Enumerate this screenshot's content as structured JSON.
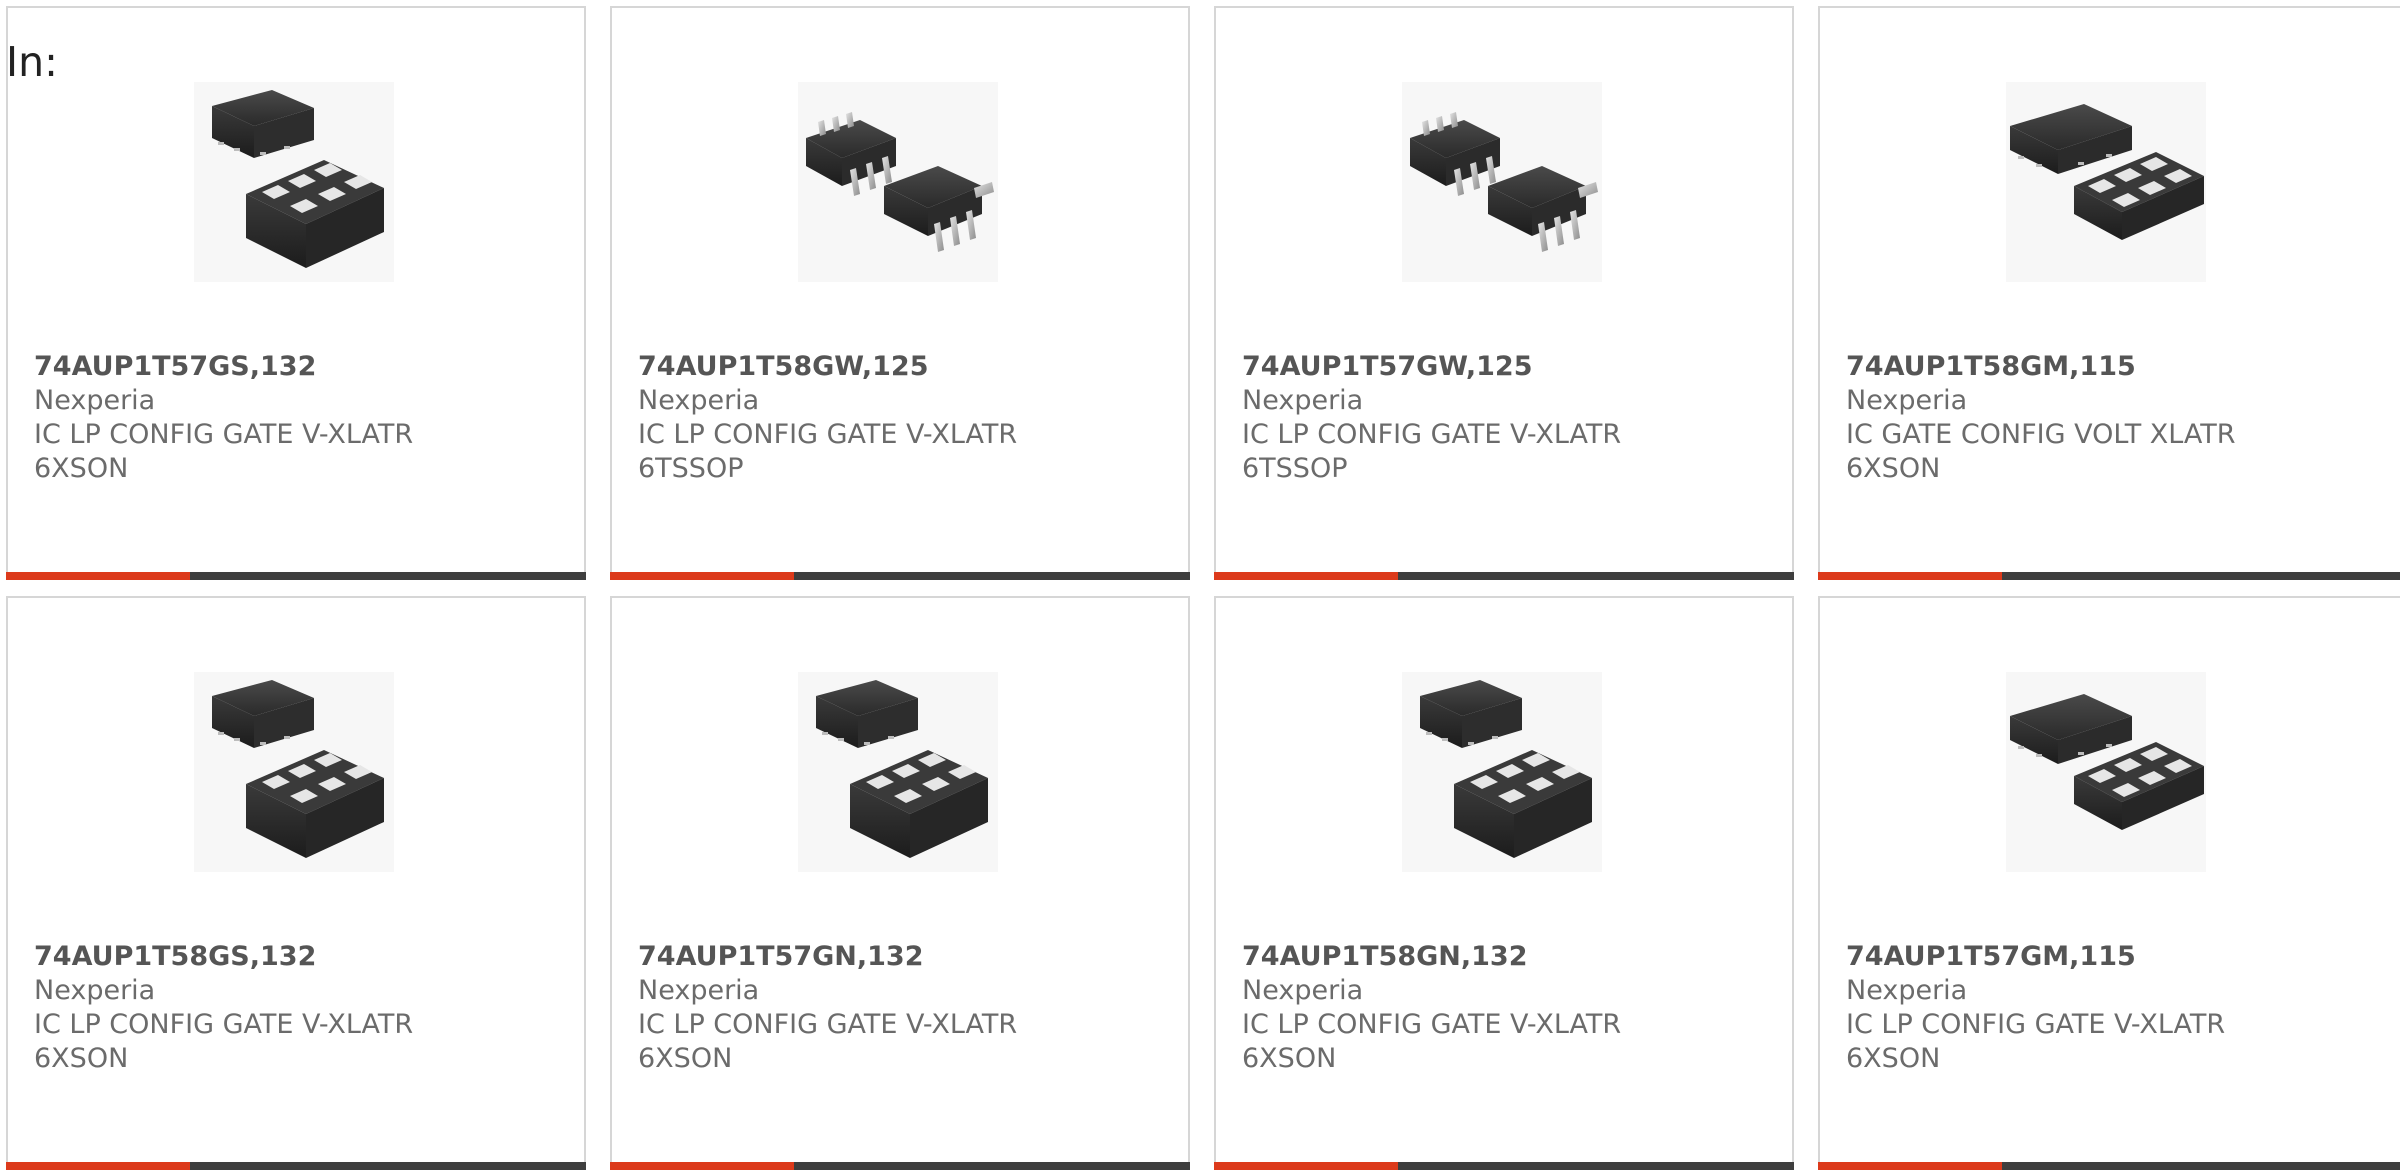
{
  "header": {
    "label": "In:"
  },
  "colors": {
    "accent": "#dc3a1b",
    "bar": "#3e3e3e",
    "border": "#d6d6d6",
    "text": "#6b6b6b"
  },
  "products": [
    {
      "part": "74AUP1T57GS,132",
      "manufacturer": "Nexperia",
      "desc1": "IC LP CONFIG GATE V-XLATR",
      "desc2": "6XSON",
      "icon": "xson-package-icon"
    },
    {
      "part": "74AUP1T58GW,125",
      "manufacturer": "Nexperia",
      "desc1": "IC LP CONFIG GATE V-XLATR",
      "desc2": "6TSSOP",
      "icon": "tssop-package-icon"
    },
    {
      "part": "74AUP1T57GW,125",
      "manufacturer": "Nexperia",
      "desc1": "IC LP CONFIG GATE V-XLATR",
      "desc2": "6TSSOP",
      "icon": "tssop-package-icon"
    },
    {
      "part": "74AUP1T58GM,115",
      "manufacturer": "Nexperia",
      "desc1": "IC GATE CONFIG VOLT XLATR",
      "desc2": "6XSON",
      "icon": "xson-flat-package-icon"
    },
    {
      "part": "74AUP1T58GS,132",
      "manufacturer": "Nexperia",
      "desc1": "IC LP CONFIG GATE V-XLATR",
      "desc2": "6XSON",
      "icon": "xson-package-icon"
    },
    {
      "part": "74AUP1T57GN,132",
      "manufacturer": "Nexperia",
      "desc1": "IC LP CONFIG GATE V-XLATR",
      "desc2": "6XSON",
      "icon": "xson-package-icon"
    },
    {
      "part": "74AUP1T58GN,132",
      "manufacturer": "Nexperia",
      "desc1": "IC LP CONFIG GATE V-XLATR",
      "desc2": "6XSON",
      "icon": "xson-package-icon"
    },
    {
      "part": "74AUP1T57GM,115",
      "manufacturer": "Nexperia",
      "desc1": "IC LP CONFIG GATE V-XLATR",
      "desc2": "6XSON",
      "icon": "xson-flat-package-icon"
    }
  ]
}
